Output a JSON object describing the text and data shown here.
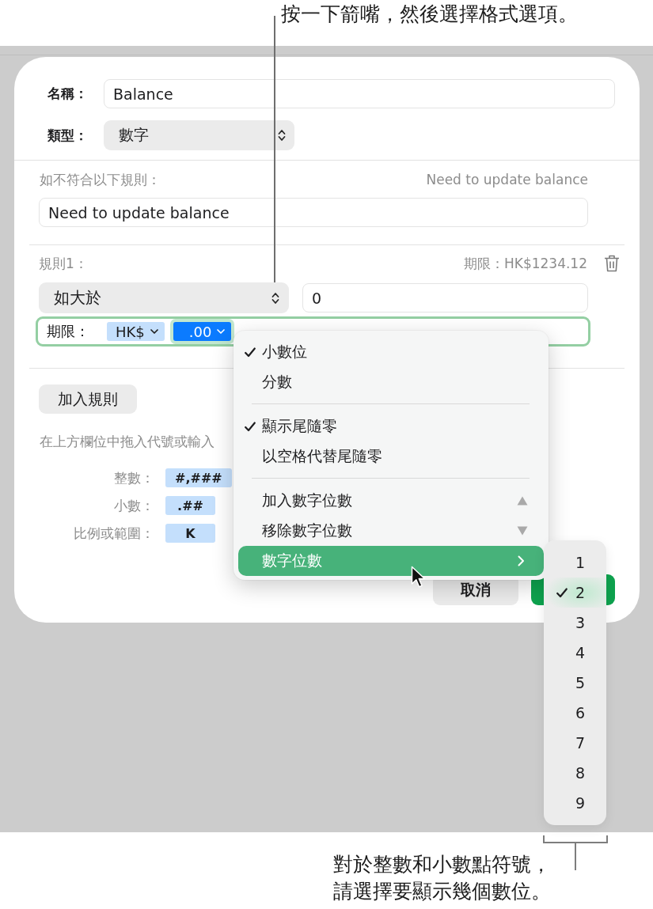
{
  "top_callout": {
    "text": "按一下箭嘴，然後選擇格式選項。"
  },
  "dialog": {
    "fields": [
      {
        "kind": "text",
        "label": "名稱：",
        "value": "Balance"
      },
      {
        "kind": "popup",
        "label": "類型：",
        "value": "數字"
      }
    ],
    "fallback": {
      "label": "如不符合以下規則：",
      "preview": "Need to update balance",
      "message": "Need to update balance"
    },
    "rules": [
      {
        "label": "規則1：",
        "preview": "期限：HK$1234.12",
        "condition": "如大於",
        "value": "0",
        "format_label": "期限：",
        "tokens": [
          {
            "label": "HK$",
            "selected": false
          },
          {
            "label": ".00",
            "selected": true
          }
        ]
      }
    ],
    "add_rule_button": "加入規則",
    "hint": "在上方欄位中拖入代號或輸入",
    "token_palette": [
      {
        "label": "整數：",
        "token": "#,###"
      },
      {
        "label": "小數：",
        "token": ".##"
      },
      {
        "label": "比例或範圍：",
        "token": "K"
      }
    ],
    "buttons": [
      {
        "kind": "cancel",
        "label": "取消"
      },
      {
        "kind": "confirm"
      }
    ]
  },
  "format_menu": {
    "groups": [
      {
        "items": [
          {
            "kind": "option",
            "label": "小數位",
            "checked": true,
            "selected": false
          },
          {
            "kind": "option",
            "label": "分數",
            "checked": false,
            "selected": false
          }
        ]
      },
      {
        "items": [
          {
            "kind": "option",
            "label": "顯示尾隨零",
            "checked": true,
            "selected": false
          },
          {
            "kind": "option",
            "label": "以空格代替尾隨零",
            "checked": false,
            "selected": false
          }
        ]
      },
      {
        "items": [
          {
            "kind": "step-up",
            "label": "加入數字位數",
            "checked": false,
            "selected": false
          },
          {
            "kind": "step-down",
            "label": "移除數字位數",
            "checked": false,
            "selected": false
          },
          {
            "kind": "submenu",
            "label": "數字位數",
            "checked": false,
            "selected": true
          }
        ]
      }
    ]
  },
  "digits_submenu": {
    "items": [
      {
        "label": "1",
        "checked": false,
        "selected": false
      },
      {
        "label": "2",
        "checked": true,
        "selected": true
      },
      {
        "label": "3",
        "checked": false,
        "selected": false
      },
      {
        "label": "4",
        "checked": false,
        "selected": false
      },
      {
        "label": "5",
        "checked": false,
        "selected": false
      },
      {
        "label": "6",
        "checked": false,
        "selected": false
      },
      {
        "label": "7",
        "checked": false,
        "selected": false
      },
      {
        "label": "8",
        "checked": false,
        "selected": false
      },
      {
        "label": "9",
        "checked": false,
        "selected": false
      }
    ]
  },
  "bottom_callout": {
    "lines": [
      "對於整數和小數點符號，",
      "請選擇要顯示幾個數位。"
    ]
  }
}
